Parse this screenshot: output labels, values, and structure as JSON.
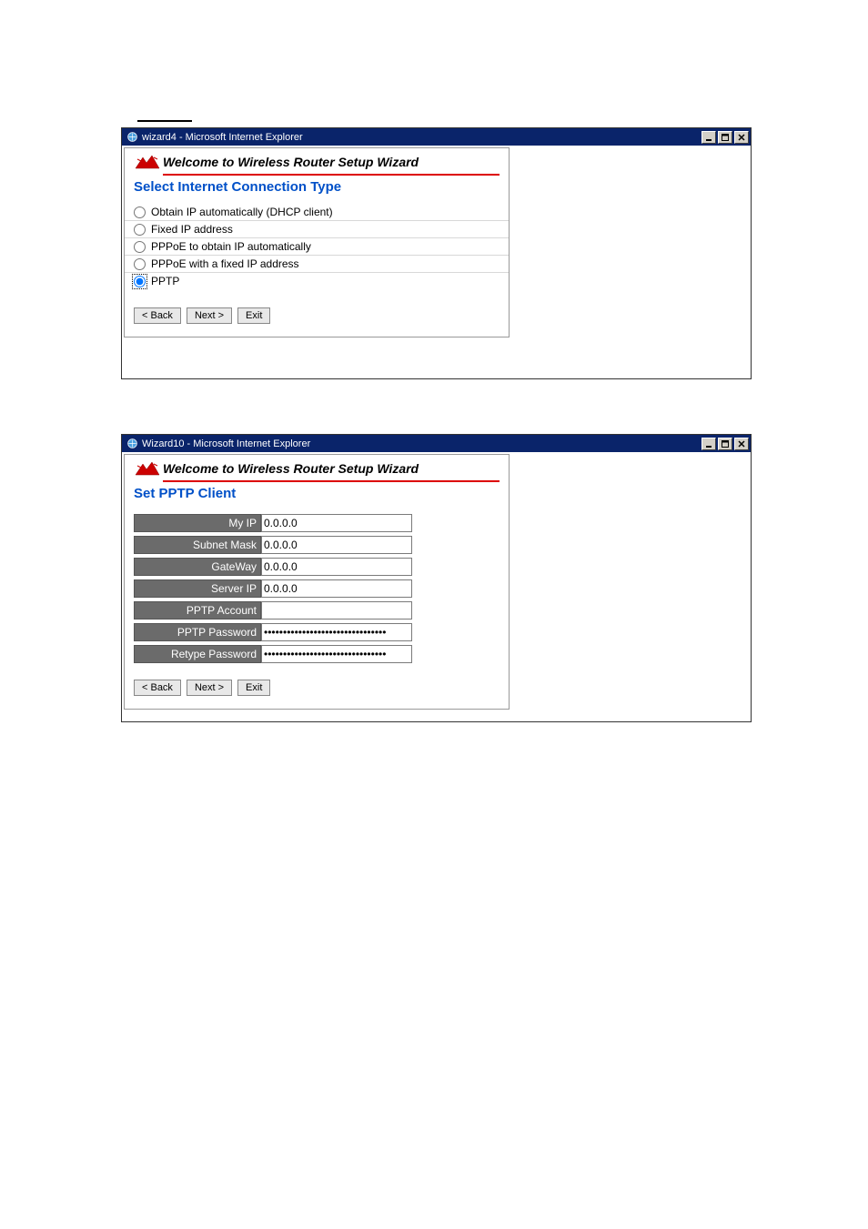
{
  "window1": {
    "title": "wizard4 - Microsoft Internet Explorer",
    "welcome": "Welcome to Wireless Router Setup Wizard",
    "section": "Select Internet Connection Type",
    "options": [
      {
        "label": "Obtain IP automatically (DHCP client)",
        "checked": false
      },
      {
        "label": "Fixed IP address",
        "checked": false
      },
      {
        "label": "PPPoE to obtain IP automatically",
        "checked": false
      },
      {
        "label": "PPPoE with a fixed IP address",
        "checked": false
      },
      {
        "label": "PPTP",
        "checked": true
      }
    ],
    "buttons": {
      "back": "< Back",
      "next": "Next >",
      "exit": "Exit"
    }
  },
  "window2": {
    "title": "Wizard10 - Microsoft Internet Explorer",
    "welcome": "Welcome to Wireless Router Setup Wizard",
    "section": "Set PPTP Client",
    "fields": {
      "myip": {
        "label": "My IP",
        "value": "0.0.0.0"
      },
      "subnet": {
        "label": "Subnet Mask",
        "value": "0.0.0.0"
      },
      "gateway": {
        "label": "GateWay",
        "value": "0.0.0.0"
      },
      "serverip": {
        "label": "Server IP",
        "value": "0.0.0.0"
      },
      "account": {
        "label": "PPTP Account",
        "value": ""
      },
      "password": {
        "label": "PPTP Password",
        "value": "********************************"
      },
      "repassword": {
        "label": "Retype Password",
        "value": "********************************"
      }
    },
    "buttons": {
      "back": "< Back",
      "next": "Next >",
      "exit": "Exit"
    }
  }
}
